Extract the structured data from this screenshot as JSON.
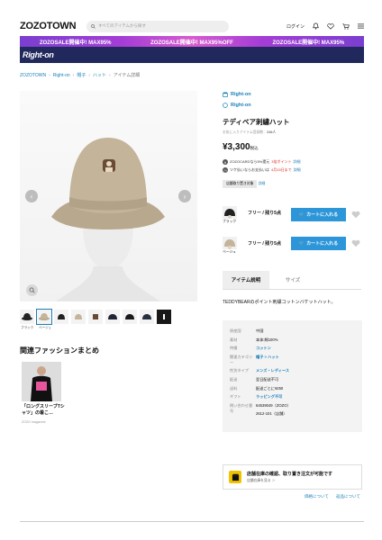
{
  "header": {
    "logo": "ZOZOTOWN",
    "search_placeholder": "すべてのアイテムから探す",
    "login": "ログイン"
  },
  "banner": {
    "items": [
      "ZOZOSALE開催中! MAX95%",
      "ZOZOSALE開催中! MAX95%OFF",
      "ZOZOSALE開催中! MAX95%"
    ]
  },
  "shop": {
    "name": "Right-on"
  },
  "breadcrumb": [
    "ZOZOTOWN",
    "Right-on",
    "帽子",
    "ハット",
    "アイテム詳細"
  ],
  "product": {
    "brand": "Right-on",
    "shop": "Right-on",
    "title": "テディベア刺繍ハット",
    "fav": "お気に入りアイテム登録数：",
    "fav_count": "246人",
    "price": "¥3,300",
    "tax": "税込",
    "points": [
      {
        "label": "ZOZOCARDなら5%還元",
        "strong": "3倍ポイント",
        "link": "詳細"
      },
      {
        "label": "ツケ払いならお支払いは",
        "strong": "4月15日まで",
        "link": "詳細"
      }
    ],
    "tag": "店舗取り置き対象",
    "tag_link": "詳細",
    "variants": [
      {
        "color": "ブラック",
        "size": "フリー / 残り5点",
        "cart": "カートに入れる"
      },
      {
        "color": "ベージュ",
        "size": "フリー / 残り5点",
        "cart": "カートに入れる"
      }
    ],
    "tabs": [
      "アイテム説明",
      "サイズ"
    ],
    "description": "TEDDYBEARのポイント刺繍コットンバケットハット。",
    "specs": [
      {
        "k": "原産国",
        "v": "中国",
        "link": false
      },
      {
        "k": "素材",
        "v": "本体:綿100%",
        "link": false
      },
      {
        "k": "特徴",
        "v": "コットン",
        "link": true
      },
      {
        "k": "関連カテゴリー",
        "v": "帽子 > ハット",
        "link": true
      }
    ],
    "specs2": [
      {
        "k": "性別タイプ",
        "v": "メンズ・レディース",
        "link": true
      },
      {
        "k": "配送",
        "v": "翌日配送不可",
        "link": false
      },
      {
        "k": "送料",
        "v": "配送ごとに¥250",
        "link": false
      },
      {
        "k": "ギフト",
        "v": "ラッピング不可",
        "link": false
      },
      {
        "k": "問い合わせ番号",
        "v": "64539049（ZOZO）",
        "link": false
      },
      {
        "k": "",
        "v": "2612-101（店舗）",
        "link": false
      }
    ],
    "store": {
      "title": "店舗在庫の確認、取り置き注文が可能です",
      "sub": "店舗在庫を見る ＞"
    },
    "links": [
      "価格について",
      "返品について"
    ]
  },
  "thumbs": {
    "labels": [
      "ブラック",
      "ベージュ"
    ]
  },
  "coordinate": {
    "heading": "関連ファッションまとめ",
    "title": "「ロングスリーブTシャツ」の着こ…",
    "source": "ZOZO magazine"
  },
  "colors": {
    "accent": "#2d96d9",
    "nav": "#21285c",
    "banner": "#a53dd6"
  }
}
